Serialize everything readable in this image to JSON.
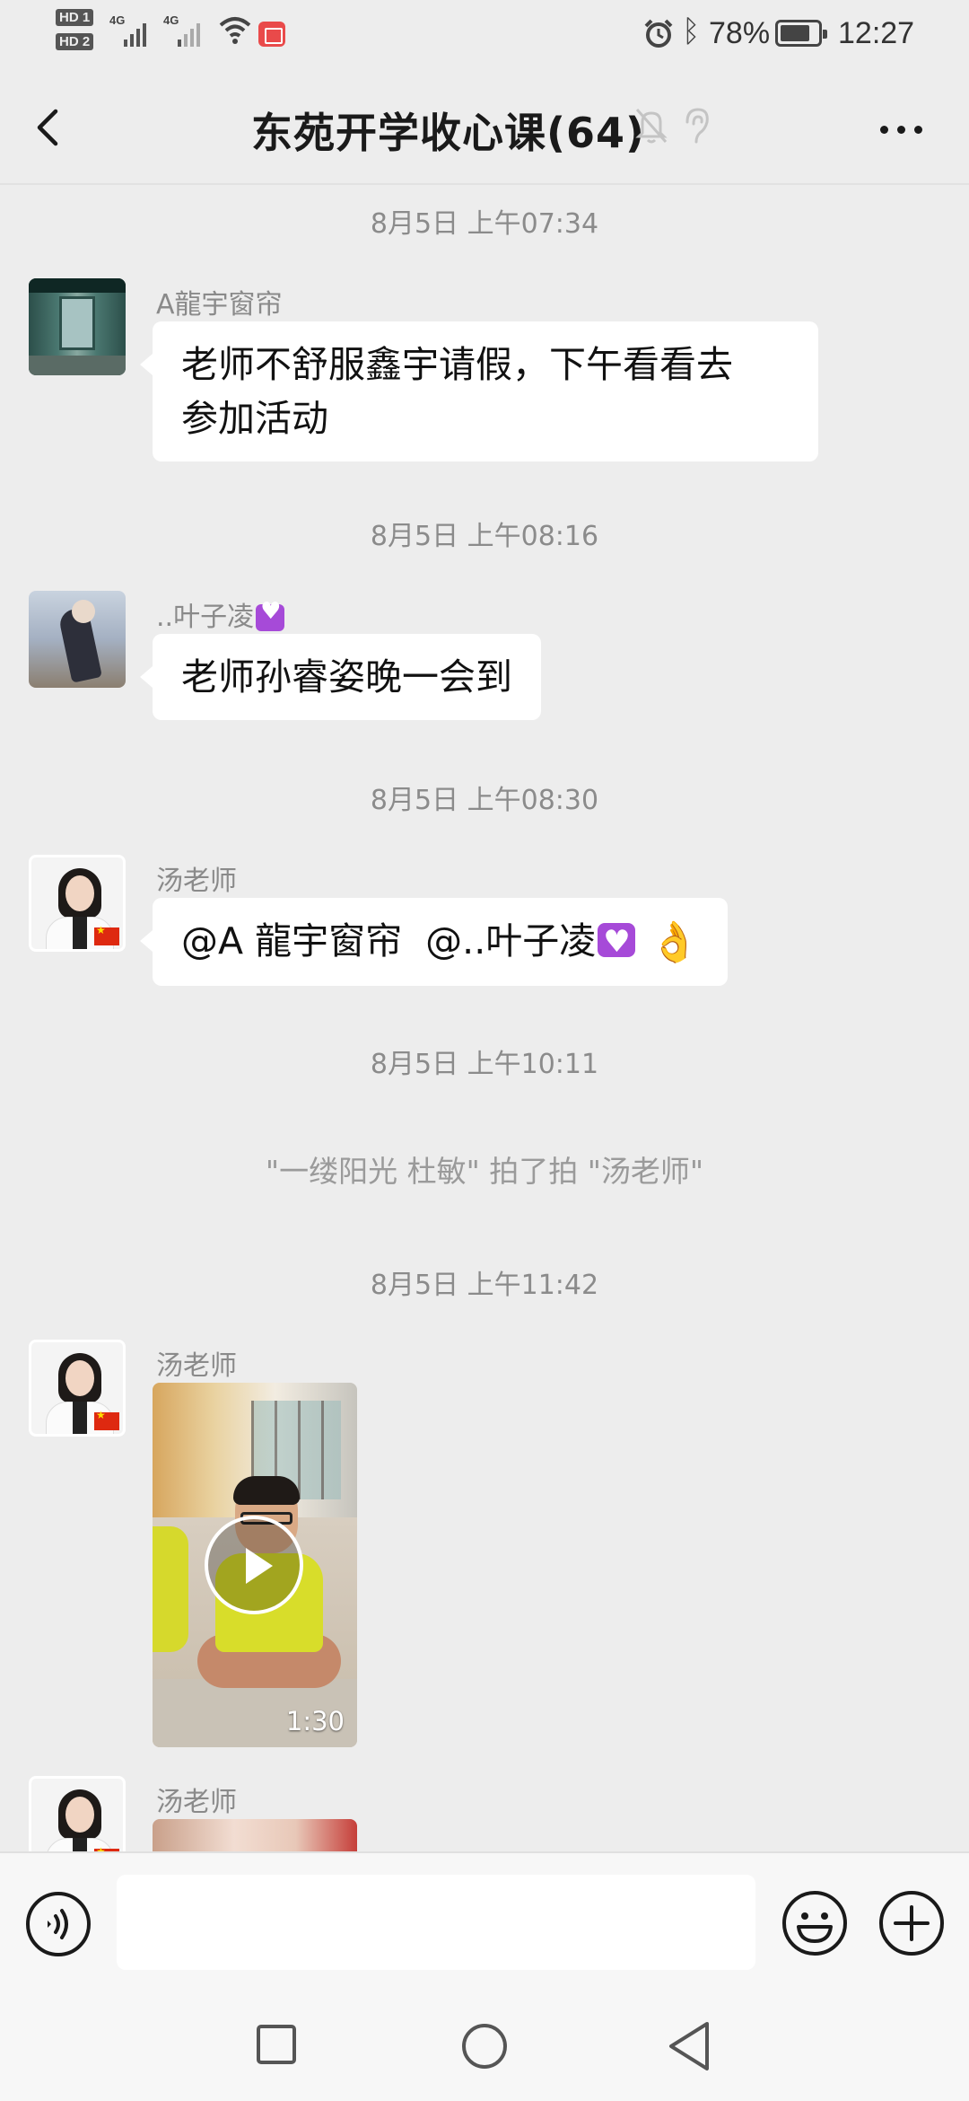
{
  "status_bar": {
    "hd1": "HD 1",
    "hd2": "HD 2",
    "net1": "4G",
    "net2": "4G",
    "battery": "78%",
    "time": "12:27"
  },
  "header": {
    "title": "东苑开学收心课(64)"
  },
  "messages": [
    {
      "timestamp": "8月5日 上午07:34",
      "sender": "A龍宇窗帘",
      "text": "老师不舒服鑫宇请假，下午看看去\n参加活动"
    },
    {
      "timestamp": "8月5日 上午08:16",
      "sender": "..叶子凌",
      "text": "老师孙睿姿晚一会到"
    },
    {
      "timestamp": "8月5日 上午08:30",
      "sender": "汤老师",
      "mention1": "@A 龍宇窗帘",
      "mention2": "@..叶子凌"
    },
    {
      "timestamp": "8月5日 上午10:11",
      "system": "\"一缕阳光 杜敏\" 拍了拍 \"汤老师\""
    },
    {
      "timestamp": "8月5日 上午11:42",
      "sender": "汤老师",
      "video_duration": "1:30"
    },
    {
      "sender": "汤老师"
    }
  ],
  "input": {
    "placeholder": ""
  }
}
